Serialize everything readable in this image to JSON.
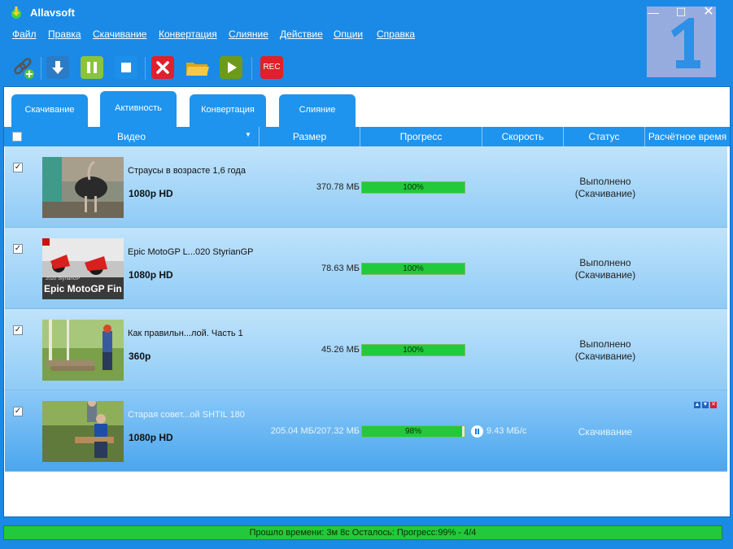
{
  "app": {
    "title": "Allavsoft"
  },
  "menu": [
    "Файл",
    "Правка",
    "Скачивание",
    "Конвертация",
    "Слияние",
    "Действие",
    "Опции",
    "Справка"
  ],
  "toolbar": {
    "rec_label": "REC"
  },
  "tabs": [
    "Скачивание",
    "Активность",
    "Конвертация",
    "Слияние"
  ],
  "columns": {
    "video": "Видео",
    "size": "Размер",
    "progress": "Прогресс",
    "speed": "Скорость",
    "status": "Статус",
    "eta": "Расчётное время"
  },
  "rows": [
    {
      "title": "Страусы в возрасте 1,6 года",
      "quality": "1080p HD",
      "size": "370.78 МБ",
      "progress": "100%",
      "progress_value": 100,
      "speed": "",
      "status_line1": "Выполнено",
      "status_line2": "(Скачивание)"
    },
    {
      "title": "Epic MotoGP L...020 StyrianGP",
      "quality": "1080p HD",
      "size": "78.63 МБ",
      "progress": "100%",
      "progress_value": 100,
      "speed": "",
      "status_line1": "Выполнено",
      "status_line2": "(Скачивание)",
      "thumb_caption": "Epic MotoGP Fin",
      "thumb_small": "2020 StyrianGP"
    },
    {
      "title": "Как правильн...лой. Часть 1",
      "quality": "360p",
      "size": "45.26 МБ",
      "progress": "100%",
      "progress_value": 100,
      "speed": "",
      "status_line1": "Выполнено",
      "status_line2": "(Скачивание)"
    },
    {
      "title": "Старая совет...ой SHTIL 180",
      "quality": "1080p HD",
      "size": "205.04 МБ/207.32 МБ",
      "progress": "98%",
      "progress_value": 98,
      "speed": "9.43 МБ/с",
      "status_line1": "Скачивание",
      "status_line2": ""
    }
  ],
  "statusbar": {
    "text": "Прошло времени: 3м  8с Осталось: Прогресс:99% - 4/4"
  },
  "colors": {
    "accent": "#1a8ae6",
    "progress": "#22c93a",
    "row_active": "#4aa6ee"
  }
}
